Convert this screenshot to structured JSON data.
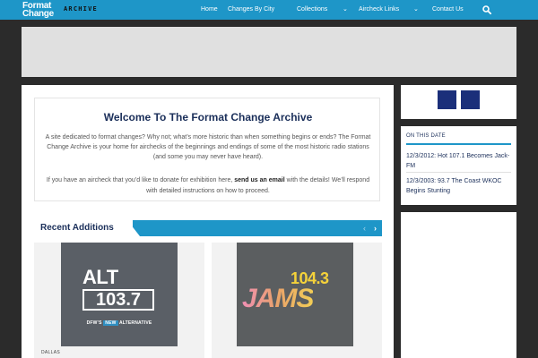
{
  "brand": {
    "line1": "Format",
    "line2": "Change",
    "suffix": "ARCHIVE"
  },
  "nav": {
    "home": "Home",
    "changes_by_city": "Changes By City",
    "collections": "Collections",
    "aircheck_links": "Aircheck Links",
    "contact_us": "Contact Us",
    "search_icon": "search-icon",
    "dropdown_icon": "chevron-down-icon"
  },
  "welcome": {
    "title": "Welcome To The Format Change Archive",
    "intro": "A site dedicated to format changes? Why not; what’s more historic than when something begins or ends? The Format Change Archive is your home for airchecks of the beginnings and endings of some of the most historic radio stations (and some you may never have heard).",
    "cta_before": "If you have an aircheck that you’d like to donate for exhibition here,",
    "cta_link": "send us an email",
    "cta_after": "with the details! We’ll respond with detailed instructions on how to proceed."
  },
  "recent": {
    "title": "Recent Additions",
    "prev_icon": "chevron-left-icon",
    "next_icon": "chevron-right-icon",
    "cards": [
      {
        "city": "DALLAS",
        "logo_word": "ALT",
        "logo_number": "103.7",
        "logo_tag_before": "DFW’S",
        "logo_tag_highlight": "NEW",
        "logo_tag_after": "ALTERNATIVE"
      },
      {
        "city": "",
        "logo_number": "104.3",
        "logo_word": "JAMS"
      }
    ]
  },
  "sidebar": {
    "on_this_date_title": "ON THIS DATE",
    "items": [
      "12/3/2012: Hot 107.1 Becomes Jack-FM",
      "12/3/2003: 93.7 The Coast WKOC Begins Stunting"
    ]
  },
  "colors": {
    "header": "#1e96c8",
    "navy": "#1b2f5a",
    "social": "#1b2f7a",
    "background": "#2b2b2b"
  }
}
